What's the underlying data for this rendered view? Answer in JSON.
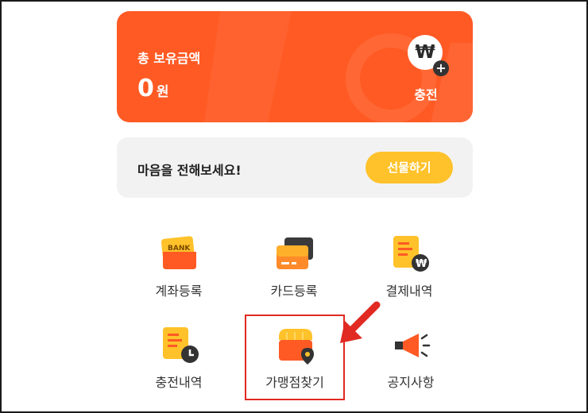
{
  "balance": {
    "title": "총 보유금액",
    "amount": "0",
    "unit": "원",
    "charge_symbol": "₩",
    "charge_plus": "+",
    "charge_label": "충전"
  },
  "gift": {
    "message": "마음을 전해보세요!",
    "button_label": "선물하기"
  },
  "menu": [
    {
      "label": "계좌등록",
      "icon": "bank-icon"
    },
    {
      "label": "카드등록",
      "icon": "card-icon"
    },
    {
      "label": "결제내역",
      "icon": "payment-history-icon"
    },
    {
      "label": "충전내역",
      "icon": "charge-history-icon"
    },
    {
      "label": "가맹점찾기",
      "icon": "store-location-icon"
    },
    {
      "label": "공지사항",
      "icon": "megaphone-icon"
    }
  ],
  "icon_text": {
    "bank": "BANK"
  },
  "colors": {
    "brand_orange": "#ff5a24",
    "gift_yellow": "#ffc22a",
    "highlight_red": "#e02a22"
  }
}
